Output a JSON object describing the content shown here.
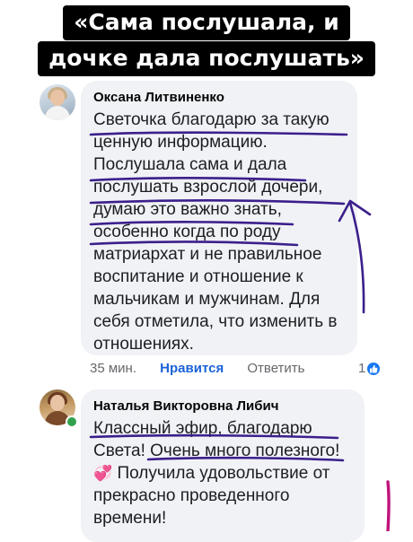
{
  "header": {
    "title_line1": "«Сама послушала, и",
    "title_line2": "дочке дала послушать»"
  },
  "comments": [
    {
      "author": "Оксана Литвиненко",
      "text": "Светочка благодарю за такую\nценную информацию.\nПослушала сама и дала\nпослушать взрослой дочери,\nдумаю это важно знать,\nособенно когда по роду\nматриархат и не правильное\nвоспитание и отношение к\nмальчикам и мужчинам. Для\nсебя отметила, что изменить в\nотношениях.",
      "time": "35 мин.",
      "like_label": "Нравится",
      "reply_label": "Ответить",
      "reaction_count": "1",
      "reaction_icon": "like-icon"
    },
    {
      "author": "Наталья Викторовна Либич",
      "text_part1": "Классный эфир, благодарю\nСвета! Очень много полезного!\n",
      "emoji": "💞",
      "text_part2": " Получила удовольствие от\nпрекрасно проведенного\nвремени!",
      "online": true
    }
  ],
  "colors": {
    "bubble": "#f0f2f5",
    "link_blue": "#1a63d8",
    "annotation_purple": "#3b1f8c",
    "annotation_magenta": "#c0137b",
    "online_green": "#31a24c"
  }
}
